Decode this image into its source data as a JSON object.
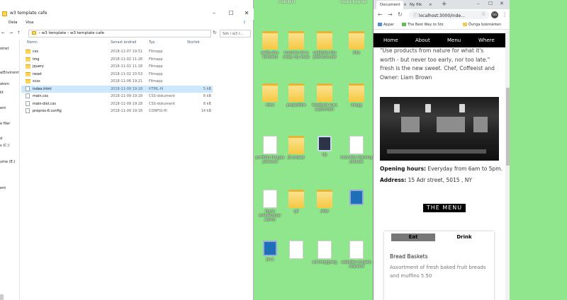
{
  "explorer": {
    "title": "w3 template cafe",
    "ribbon": [
      "Dela",
      "Visa"
    ],
    "breadcrumb": [
      "w3 template",
      "w3 template cafe"
    ],
    "search_placeholder": "Sök i w3 t...",
    "columns": {
      "name": "Namn",
      "date": "Senast ändrad",
      "type": "Typ",
      "size": "Storlek"
    },
    "nav_items": [
      "omst",
      "alEnvironm",
      "atorn",
      "kt",
      "ent",
      "e filer",
      "d",
      "s (C:)",
      "ume (E:)",
      "ent"
    ],
    "files": [
      {
        "name": "css",
        "date": "2018-11-07 19:51",
        "type": "Filmapp",
        "size": "",
        "icon": "folder-icon"
      },
      {
        "name": "img",
        "date": "2018-11-02 11:28",
        "type": "Filmapp",
        "size": "",
        "icon": "folder-icon"
      },
      {
        "name": "jquery",
        "date": "2018-11-02 11:18",
        "type": "Filmapp",
        "size": "",
        "icon": "folder-icon"
      },
      {
        "name": "reset",
        "date": "2018-11-02 10:53",
        "type": "Filmapp",
        "size": "",
        "icon": "folder-icon"
      },
      {
        "name": "scss",
        "date": "2018-11-08 19:21",
        "type": "Filmapp",
        "size": "",
        "icon": "folder-icon"
      },
      {
        "name": "index.html",
        "date": "2018-11-09 19:18",
        "type": "HTML-fil",
        "size": "5 kB",
        "icon": "html-file-icon",
        "selected": true
      },
      {
        "name": "main.css",
        "date": "2018-11-09 19:18",
        "type": "CSS-dokument",
        "size": "8 kB",
        "icon": "css-file-icon"
      },
      {
        "name": "main-dist.css",
        "date": "2018-11-09 19:18",
        "type": "CSS-dokument",
        "size": "8 kB",
        "icon": "css-file-icon"
      },
      {
        "name": "prepros-6.config",
        "date": "2018-11-09 19:18",
        "type": "CONFIG-fil",
        "size": "14 kB",
        "icon": "config-file-icon"
      }
    ]
  },
  "desktop": {
    "top_labels": [
      "",
      "mobilbild",
      "",
      "modul-kurs-del",
      ""
    ],
    "icons": [
      {
        "label": "webb-dev-frontend",
        "kind": "folder"
      },
      {
        "label": "mood to do in crazy my week",
        "kind": "folder"
      },
      {
        "label": "webbdev-the jobb-kurs-del",
        "kind": "folder"
      },
      {
        "label": "foto",
        "kind": "folder"
      },
      {
        "label": "html",
        "kind": "folder"
      },
      {
        "label": "projektfilm",
        "kind": "folder"
      },
      {
        "label": "feedback kurs september",
        "kind": "folder"
      },
      {
        "label": "inlogg",
        "kind": "folder"
      },
      {
        "label": "portfolio images personal",
        "kind": "file"
      },
      {
        "label": "JS project",
        "kind": "folder"
      },
      {
        "label": "tip",
        "kind": "dark"
      },
      {
        "label": "interview learning process",
        "kind": "file"
      },
      {
        "label": "log-in erfarenheter admin",
        "kind": "file"
      },
      {
        "label": "git",
        "kind": "folder"
      },
      {
        "label": "slide",
        "kind": "folder"
      },
      {
        "label": "",
        "kind": "vsc"
      },
      {
        "label": "Java",
        "kind": "vsc"
      },
      {
        "label": "",
        "kind": "file"
      },
      {
        "label": "w3 inloggning",
        "kind": "file"
      },
      {
        "label": "webbdev projekt-relaterat",
        "kind": "file"
      },
      {
        "label": "programming basics",
        "kind": "folder"
      },
      {
        "label": "",
        "kind": "app"
      },
      {
        "label": "frontend challenges",
        "kind": "folder"
      },
      {
        "label": "inspiration",
        "kind": "folder"
      }
    ]
  },
  "browser": {
    "tabs": [
      "Document",
      "Ny flik"
    ],
    "new_tab": "+",
    "url": "localhost:3000/inde...",
    "avatar_initials": "GG",
    "bookmarks": [
      "Appar",
      "The Best Way to Sto",
      "Övriga bokmärken"
    ],
    "page": {
      "nav": [
        "Home",
        "About",
        "Menu",
        "Where"
      ],
      "quote": "\"Use products from nature for what it's worth - but never too early, nor too late.\" Fresh is the new sweet. Chef, Coffeeist and Owner: Liam Brown",
      "opening_label": "Opening hours:",
      "opening_value": "Everyday from 6am to 5pm.",
      "address_label": "Address:",
      "address_value": "15 Adr street, 5015 , NY",
      "menu_button": "THE MENU",
      "menu_tabs": [
        "Eat",
        "Drink"
      ],
      "item_title": "Bread Baskets",
      "item_desc": "Assortment of fresh baked fruit breads and muffins 5.50"
    }
  },
  "colors": {
    "desktop_bg": "#8fe68c",
    "selection": "#cce8ff",
    "nav_black": "#000000"
  }
}
